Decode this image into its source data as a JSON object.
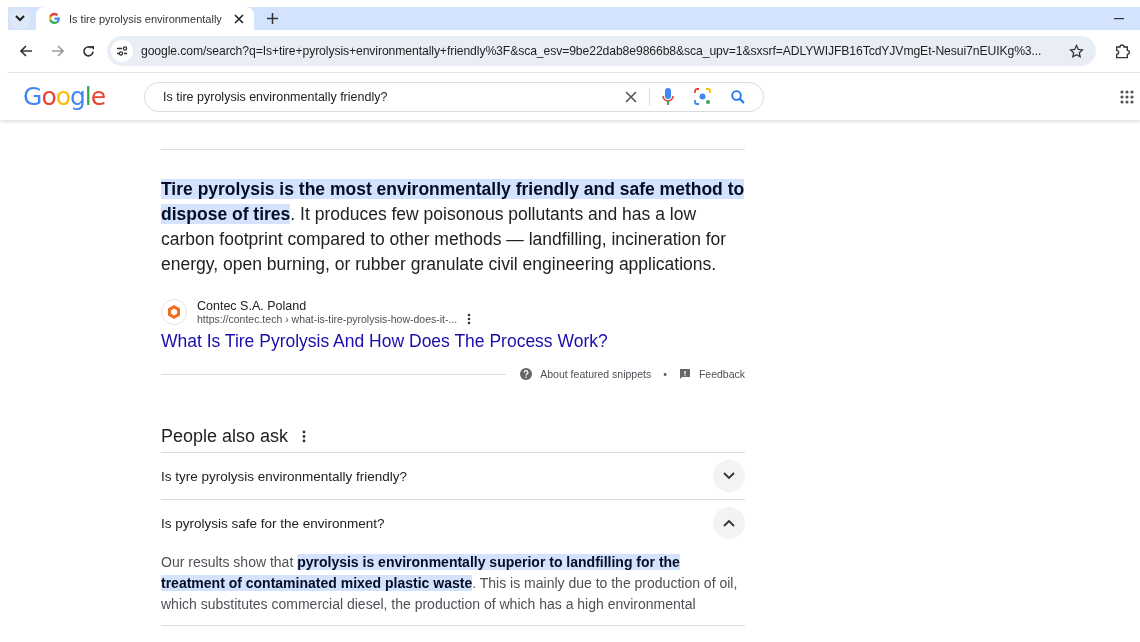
{
  "tab": {
    "title": "Is tire pyrolysis environmentally",
    "selected": true
  },
  "address_bar": {
    "url": "google.com/search?q=Is+tire+pyrolysis+environmentally+friendly%3F&sca_esv=9be22dab8e9866b8&sca_upv=1&sxsrf=ADLYWIJFB16TcdYJVmgEt-Nesui7nEUIKg%3..."
  },
  "search": {
    "logo": "Google",
    "value": "Is tire pyrolysis environmentally friendly?"
  },
  "featured_snippet": {
    "text": "**Tire pyrolysis is the most environmentally friendly and safe method to dispose of tires**. It produces few poisonous pollutants and has a low carbon footprint compared to other methods — landfilling, incineration for energy, open burning, or rubber granulate civil engineering applications.",
    "source_name": "Contec S.A. Poland",
    "source_url": "https://contec.tech › what-is-tire-pyrolysis-how-does-it-...",
    "link": "What Is Tire Pyrolysis And How Does The Process Work?",
    "about": "About featured snippets",
    "separator": "•",
    "feedback": "Feedback"
  },
  "people_also_ask": {
    "title": "People also ask",
    "questions": [
      {
        "text": "Is tyre pyrolysis environmentally friendly?",
        "expanded": false
      },
      {
        "text": "Is pyrolysis safe for the environment?",
        "expanded": true,
        "answer": "Our results show that **pyrolysis is environmentally superior to landfilling for the treatment of contaminated mixed plastic waste**. This is mainly due to the production of oil, which substitutes commercial diesel, the production of which has a high environmental"
      }
    ]
  }
}
